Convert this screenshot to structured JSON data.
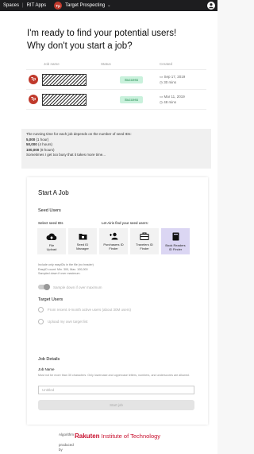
{
  "topbar": {
    "spaces": "Spaces",
    "rit_apps": "RIT Apps",
    "project_initials": "Tp",
    "project_name": "Target Prospecting",
    "chevron": "⌄",
    "user_icon": "user-icon"
  },
  "hero": {
    "line1": "I'm ready to find your potential users!",
    "line2": "Why don't you start a job?"
  },
  "jobs": {
    "headers": [
      "Job name",
      "Status",
      "Created"
    ],
    "rows": [
      {
        "initials": "Tp",
        "status": "Success",
        "date": "Sep 17, 2019",
        "duration": "30 mins"
      },
      {
        "initials": "Tp",
        "status": "Success",
        "date": "Mar 11, 2019",
        "duration": "48 mins"
      }
    ]
  },
  "notice": {
    "line1": "The running time for each job depends on the number of seed IDs:",
    "r1_num": "5,000",
    "r1_text": " (1 hour)",
    "r2_num": "50,000",
    "r2_text": " (4 hours)",
    "r3_num": "100,000",
    "r3_text": " (8 hours)",
    "footer": "Sometimes I get too busy that it takes more time..."
  },
  "start_job": {
    "title": "Start A Job",
    "seed_users": "Seed Users",
    "select_seed": "Select seed IDs",
    "let_airis": "Let Airis find your seed users:",
    "tiles": [
      {
        "label1": "File",
        "label2": "Upload",
        "icon": "cloud-upload-icon"
      },
      {
        "label1": "Seed ID",
        "label2": "Manager",
        "icon": "folder-icon"
      },
      {
        "label1": "Purchasers ID",
        "label2": "Finder",
        "icon": "add-user-icon"
      },
      {
        "label1": "Travelers ID",
        "label2": "Finder",
        "icon": "briefcase-icon"
      },
      {
        "label1": "Book Readers",
        "label2": "ID Finder",
        "icon": "book-icon"
      }
    ],
    "hint1": "Include only easyIDs in the file (no header)",
    "hint2": "EasyID count: Min. 300, Max. 100,000",
    "hint3": "Sampled down if over maximum.",
    "toggle_label": "Sample down if over maximum",
    "target_users": "Target Users",
    "radio1": "From recent 4-month active users (about 30M users)",
    "radio2": "Upload my own target list",
    "job_details": "Job Details",
    "job_name": "Job Name",
    "job_name_desc": "Must not be more than 30 characters. Only lowercase and uppercase letters, numbers, and underscores are allowed.",
    "input_value": "Untitled",
    "start_button": "Start job"
  },
  "footer": {
    "pre1": "Algorithm",
    "pre2": "produced",
    "pre3": "by",
    "brand": "Rakuten",
    "rest": "Institute of Technology",
    "brand_color": "#c8102e"
  }
}
